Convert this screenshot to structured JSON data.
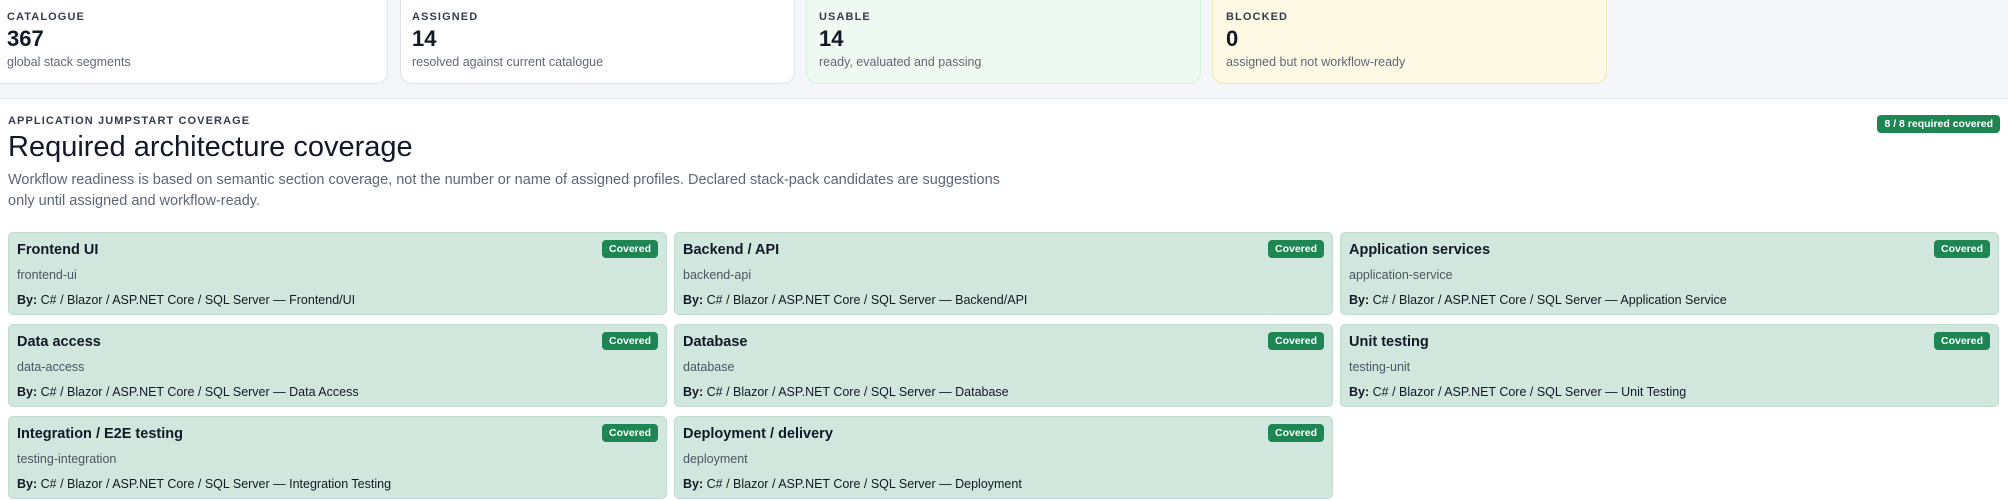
{
  "stats": [
    {
      "label": "CATALOGUE",
      "value": "367",
      "desc": "global stack segments",
      "variant": "default"
    },
    {
      "label": "ASSIGNED",
      "value": "14",
      "desc": "resolved against current catalogue",
      "variant": "default"
    },
    {
      "label": "USABLE",
      "value": "14",
      "desc": "ready, evaluated and passing",
      "variant": "usable"
    },
    {
      "label": "BLOCKED",
      "value": "0",
      "desc": "assigned but not workflow-ready",
      "variant": "blocked"
    }
  ],
  "panel": {
    "eyebrow": "APPLICATION JUMPSTART COVERAGE",
    "title": "Required architecture coverage",
    "description": "Workflow readiness is based on semantic section coverage, not the number or name of assigned profiles. Declared stack-pack candidates are suggestions only until assigned and workflow-ready.",
    "summary_badge": "8 / 8 required covered"
  },
  "by_label": "By:",
  "cards": [
    {
      "title": "Frontend UI",
      "slug": "frontend-ui",
      "by": "C# / Blazor / ASP.NET Core / SQL Server — Frontend/UI",
      "status": "Covered"
    },
    {
      "title": "Backend / API",
      "slug": "backend-api",
      "by": "C# / Blazor / ASP.NET Core / SQL Server — Backend/API",
      "status": "Covered"
    },
    {
      "title": "Application services",
      "slug": "application-service",
      "by": "C# / Blazor / ASP.NET Core / SQL Server — Application Service",
      "status": "Covered"
    },
    {
      "title": "Data access",
      "slug": "data-access",
      "by": "C# / Blazor / ASP.NET Core / SQL Server — Data Access",
      "status": "Covered"
    },
    {
      "title": "Database",
      "slug": "database",
      "by": "C# / Blazor / ASP.NET Core / SQL Server — Database",
      "status": "Covered"
    },
    {
      "title": "Unit testing",
      "slug": "testing-unit",
      "by": "C# / Blazor / ASP.NET Core / SQL Server — Unit Testing",
      "status": "Covered"
    },
    {
      "title": "Integration / E2E testing",
      "slug": "testing-integration",
      "by": "C# / Blazor / ASP.NET Core / SQL Server — Integration Testing",
      "status": "Covered"
    },
    {
      "title": "Deployment / delivery",
      "slug": "deployment",
      "by": "C# / Blazor / ASP.NET Core / SQL Server — Deployment",
      "status": "Covered"
    }
  ],
  "colors": {
    "covered_badge": "#1e8653",
    "card_bg": "#d1e7dd",
    "usable_bg": "#eefaf1",
    "blocked_bg": "#fdf9e5"
  }
}
